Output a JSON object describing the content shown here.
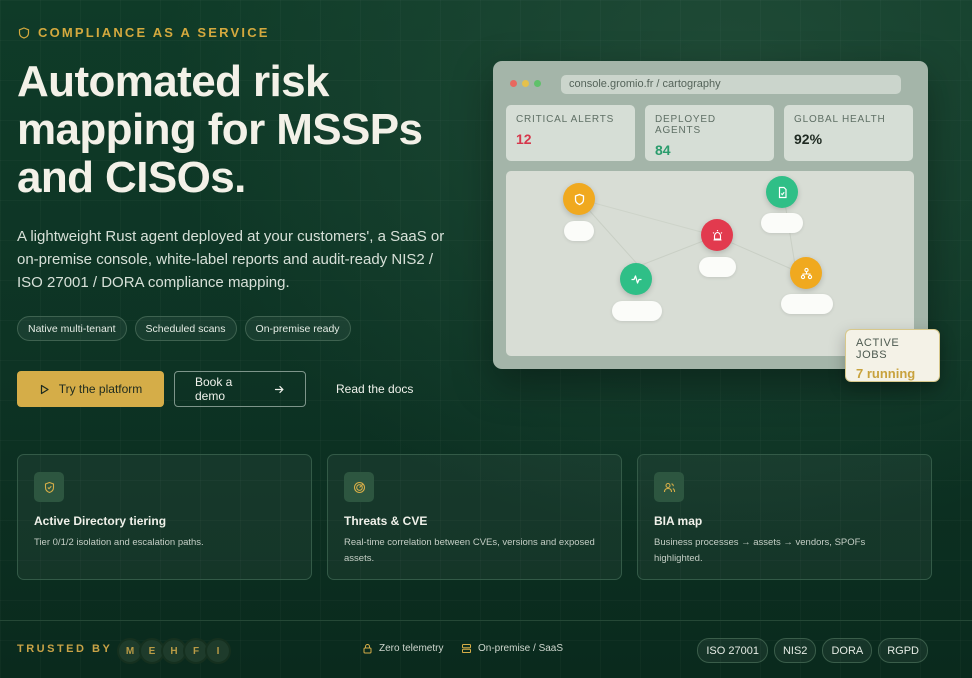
{
  "hero": {
    "eyebrow": "COMPLIANCE AS A SERVICE",
    "title": "Automated risk mapping for MSSPs and CISOs.",
    "lead": "A lightweight Rust agent deployed at your customers', a SaaS or on-premise console, white-label reports and audit-ready NIS2 / ISO 27001 / DORA compliance mapping.",
    "pills": [
      "Native multi-tenant",
      "Scheduled scans",
      "On-premise ready"
    ],
    "cta_primary": "Try the platform",
    "cta_secondary": "Book a demo",
    "cta_tertiary": "Read the docs"
  },
  "console": {
    "url": "console.gromio.fr / cartography",
    "stats": [
      {
        "label": "CRITICAL ALERTS",
        "value": "12",
        "color": "#d6374b"
      },
      {
        "label": "DEPLOYED AGENTS",
        "value": "84",
        "color": "#2a9c6c"
      },
      {
        "label": "GLOBAL HEALTH",
        "value": "92%",
        "color": "#1f2a22"
      }
    ],
    "nodes": [
      {
        "icon": "shield-icon",
        "color": "#f0a91f"
      },
      {
        "icon": "document-icon",
        "color": "#2fbf87"
      },
      {
        "icon": "alarm-icon",
        "color": "#e23a4e"
      },
      {
        "icon": "pulse-icon",
        "color": "#2fbf87"
      },
      {
        "icon": "network-icon",
        "color": "#f0a91f"
      }
    ],
    "jobs_label": "ACTIVE JOBS",
    "jobs_value": "7 running"
  },
  "features": [
    {
      "icon": "shield-check-icon",
      "title": "Active Directory tiering",
      "desc": "Tier 0/1/2 isolation and escalation paths."
    },
    {
      "icon": "radar-icon",
      "title": "Threats & CVE",
      "desc": "Real-time correlation between CVEs, versions and exposed assets."
    },
    {
      "icon": "users-icon",
      "title": "BIA map",
      "desc": "Business processes → assets → vendors, SPOFs highlighted."
    }
  ],
  "footer": {
    "trusted_label": "TRUSTED BY",
    "logos": [
      "M",
      "E",
      "H",
      "F",
      "I"
    ],
    "meta_1": "Zero telemetry",
    "meta_2": "On-premise / SaaS",
    "badges": [
      "ISO 27001",
      "NIS2",
      "DORA",
      "RGPD"
    ]
  },
  "colors": {
    "accent": "#d5ad48",
    "background": "#0f3b28"
  }
}
